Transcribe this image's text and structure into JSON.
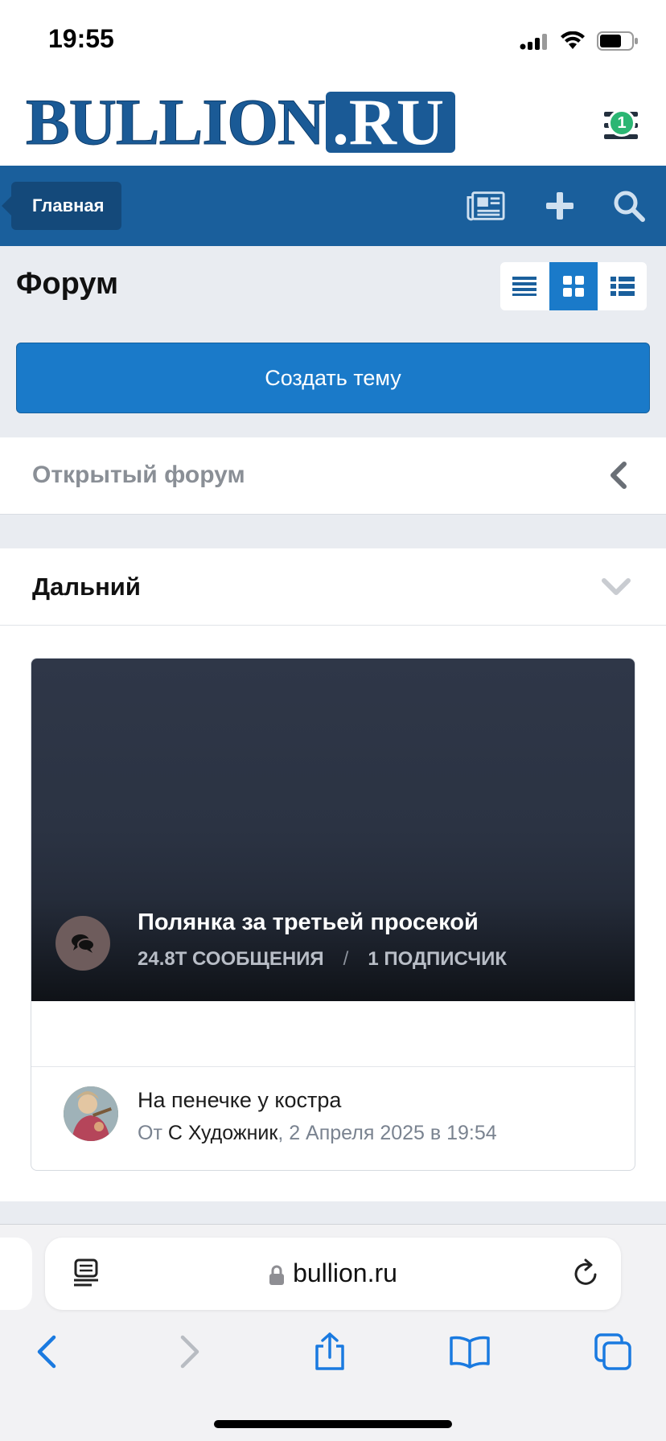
{
  "status_bar": {
    "time": "19:55"
  },
  "header": {
    "logo_main": "BULLION",
    "logo_suffix": ".RU",
    "menu_badge": "1"
  },
  "navbar": {
    "home_label": "Главная"
  },
  "page": {
    "title": "Форум",
    "create_topic_label": "Создать тему"
  },
  "sections": {
    "open_forum": "Открытый форум",
    "far": "Дальний"
  },
  "forum_card": {
    "title": "Полянка за третьей просекой",
    "messages": "24.8Т СООБЩЕНИЯ",
    "separator": "/",
    "followers": "1 ПОДПИСЧИК",
    "last_post_title": "На пенечке у костра",
    "last_post_by": "От",
    "last_post_author": "С Художник",
    "last_post_date": ", 2 Апреля 2025 в 19:54"
  },
  "browser": {
    "url": "bullion.ru"
  },
  "colors": {
    "brand_blue": "#1a5f9c",
    "button_blue": "#1a7ac9",
    "badge_green": "#2bb673"
  }
}
